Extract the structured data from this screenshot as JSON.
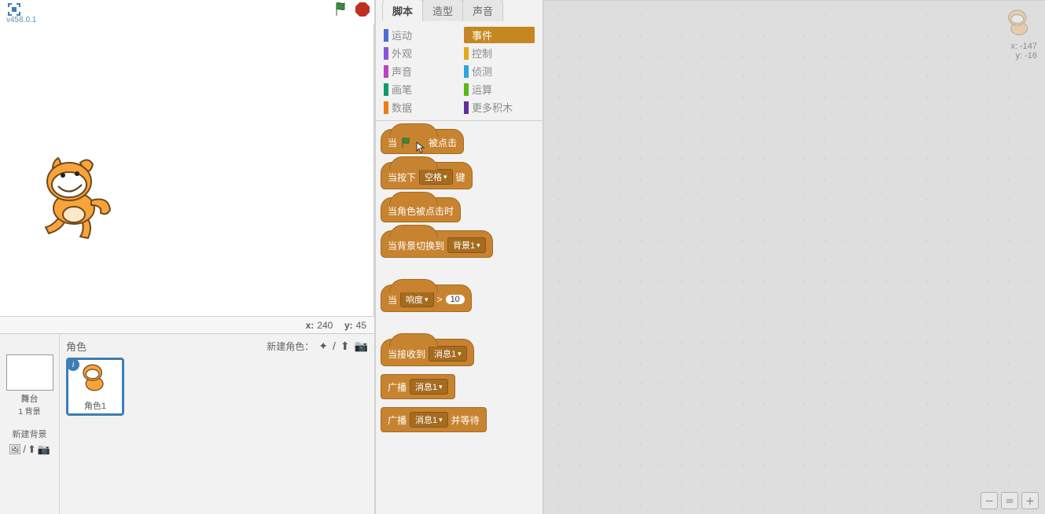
{
  "version": "v458.0.1",
  "stage": {
    "coords": {
      "x_label": "x:",
      "x_val": "240",
      "y_label": "y:",
      "y_val": "45"
    }
  },
  "stage_panel": {
    "stage_label": "舞台",
    "backdrop_count": "1 背景",
    "new_backdrop": "新建背景"
  },
  "sprite_panel": {
    "header": "角色",
    "new_sprite": "新建角色：",
    "sprite1_name": "角色1"
  },
  "tabs": {
    "scripts": "脚本",
    "costumes": "造型",
    "sounds": "声音"
  },
  "categories": {
    "motion": "运动",
    "events": "事件",
    "looks": "外观",
    "control": "控制",
    "sound": "声音",
    "sensing": "侦测",
    "pen": "画笔",
    "operators": "运算",
    "data": "数据",
    "more": "更多积木"
  },
  "blocks": {
    "when_flag": {
      "pre": "当",
      "post": "被点击"
    },
    "when_key": {
      "pre": "当按下",
      "dd": "空格",
      "post": "键"
    },
    "when_sprite_clicked": "当角色被点击时",
    "when_backdrop": {
      "pre": "当背景切换到",
      "dd": "背景1"
    },
    "when_loudness": {
      "pre": "当",
      "dd": "响度",
      "op": ">",
      "num": "10"
    },
    "when_receive": {
      "pre": "当接收到",
      "dd": "消息1"
    },
    "broadcast": {
      "pre": "广播",
      "dd": "消息1"
    },
    "broadcast_wait": {
      "pre": "广播",
      "dd": "消息1",
      "post": "并等待"
    }
  },
  "script_area": {
    "x_label": "x:",
    "x_val": "-147",
    "y_label": "y:",
    "y_val": "-16"
  }
}
